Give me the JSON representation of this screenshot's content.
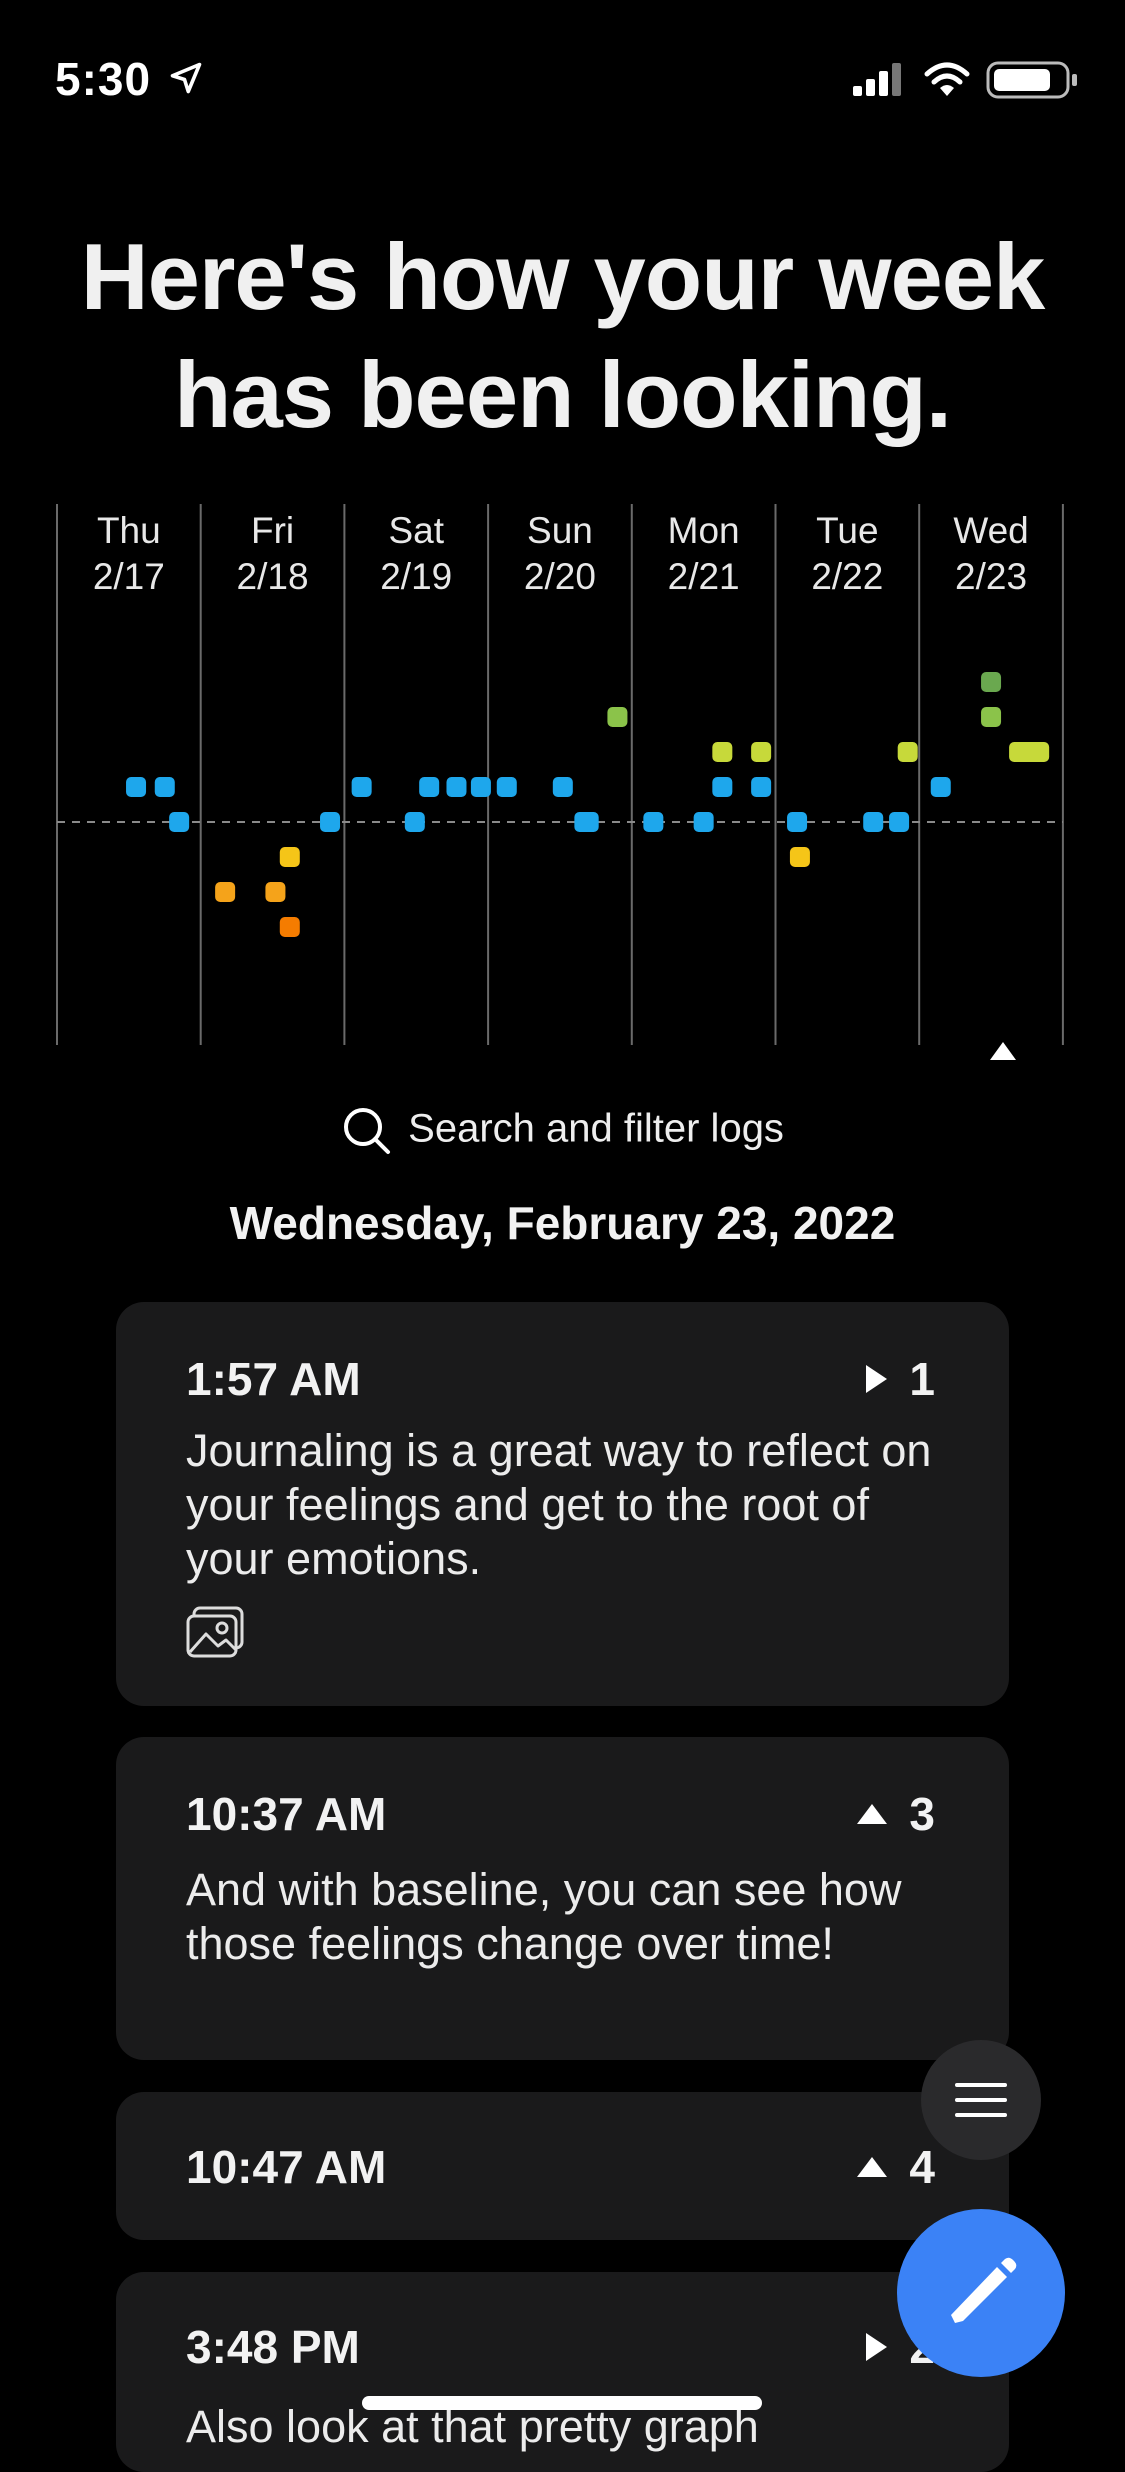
{
  "status_bar": {
    "time": "5:30",
    "icons": [
      "location-arrow-icon",
      "cellular-signal-icon",
      "wifi-icon",
      "battery-icon"
    ]
  },
  "headline": {
    "line1": "Here's how your week",
    "line2": "has been looking."
  },
  "chart_data": {
    "type": "scatter",
    "days": [
      {
        "name": "Thu",
        "date": "2/17"
      },
      {
        "name": "Fri",
        "date": "2/18"
      },
      {
        "name": "Sat",
        "date": "2/19"
      },
      {
        "name": "Sun",
        "date": "2/20"
      },
      {
        "name": "Mon",
        "date": "2/21"
      },
      {
        "name": "Tue",
        "date": "2/22"
      },
      {
        "name": "Wed",
        "date": "2/23"
      }
    ],
    "ylim": [
      -3,
      4
    ],
    "baseline": 0,
    "level_colors": {
      "4": "#6aa84f",
      "3": "#8bc34a",
      "2": "#c7d93a",
      "1": "#1ea7ec",
      "0": "#1ea7ec",
      "-1": "#f5c518",
      "-2": "#f5a31a",
      "-3": "#f57c00"
    },
    "points": [
      {
        "x": 0.55,
        "y": 1
      },
      {
        "x": 0.75,
        "y": 1
      },
      {
        "x": 0.85,
        "y": 0
      },
      {
        "x": 1.17,
        "y": -2
      },
      {
        "x": 1.52,
        "y": -2
      },
      {
        "x": 1.62,
        "y": -1
      },
      {
        "x": 1.62,
        "y": -3
      },
      {
        "x": 1.9,
        "y": 0
      },
      {
        "x": 2.12,
        "y": 1
      },
      {
        "x": 2.49,
        "y": 0
      },
      {
        "x": 2.59,
        "y": 1
      },
      {
        "x": 2.78,
        "y": 1
      },
      {
        "x": 2.95,
        "y": 1
      },
      {
        "x": 3.13,
        "y": 1
      },
      {
        "x": 3.52,
        "y": 1
      },
      {
        "x": 3.67,
        "y": 0
      },
      {
        "x": 3.7,
        "y": 0
      },
      {
        "x": 3.9,
        "y": 3
      },
      {
        "x": 4.15,
        "y": 0
      },
      {
        "x": 4.5,
        "y": 0
      },
      {
        "x": 4.63,
        "y": 2
      },
      {
        "x": 4.63,
        "y": 1
      },
      {
        "x": 4.9,
        "y": 2
      },
      {
        "x": 4.9,
        "y": 1
      },
      {
        "x": 5.15,
        "y": 0
      },
      {
        "x": 5.17,
        "y": -1
      },
      {
        "x": 5.68,
        "y": 0
      },
      {
        "x": 5.86,
        "y": 0
      },
      {
        "x": 5.92,
        "y": 2
      },
      {
        "x": 6.15,
        "y": 1
      },
      {
        "x": 6.5,
        "y": 4
      },
      {
        "x": 6.5,
        "y": 3
      },
      {
        "x": 6.73,
        "y": 2
      },
      {
        "x": 6.8,
        "y": 2
      }
    ]
  },
  "search": {
    "label": "Search and filter logs"
  },
  "date_heading": "Wednesday, February 23, 2022",
  "logs": [
    {
      "time": "1:57 AM",
      "badge_icon": "play-triangle-icon",
      "badge_value": "1",
      "text": "Journaling is a great way to reflect on your feelings and get to the root of your emotions.",
      "has_image": true
    },
    {
      "time": "10:37 AM",
      "badge_icon": "up-triangle-icon",
      "badge_value": "3",
      "text": "And with baseline, you can see how those feelings change over time!",
      "has_image": false
    },
    {
      "time": "10:47 AM",
      "badge_icon": "up-triangle-icon",
      "badge_value": "4",
      "text": "",
      "has_image": false
    },
    {
      "time": "3:48 PM",
      "badge_icon": "play-triangle-icon",
      "badge_value": "2",
      "text": "Also look at that pretty graph",
      "has_image": false
    }
  ],
  "fabs": {
    "menu_icon": "hamburger-menu-icon",
    "edit_icon": "pencil-icon"
  }
}
